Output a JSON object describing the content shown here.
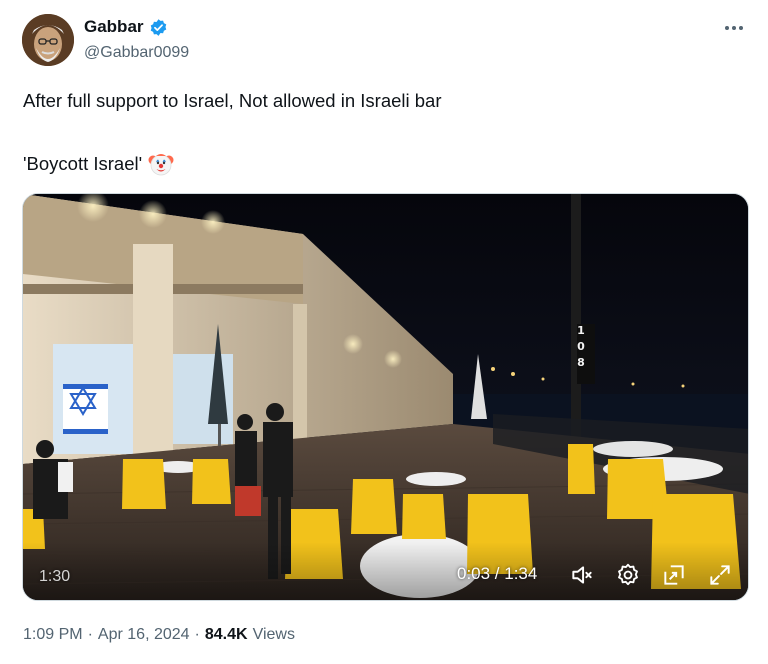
{
  "author": {
    "name": "Gabbar",
    "handle": "@Gabbar0099",
    "verified": true
  },
  "tweet": {
    "line1": "After full support to Israel, Not allowed in Israeli bar",
    "line2": "'Boycott Israel'",
    "emoji": "clown-face"
  },
  "video": {
    "counter": "1:30",
    "time": "0:03 / 1:34",
    "controls": [
      "mute-icon",
      "settings-icon",
      "fullscreen-exit-icon",
      "expand-icon"
    ]
  },
  "meta": {
    "time": "1:09 PM",
    "date": "Apr 16, 2024",
    "separator": "·",
    "views_count": "84.4K",
    "views_label": "Views"
  },
  "colors": {
    "verified": "#1d9bf0",
    "secondary_text": "#536471",
    "primary_text": "#0f1419"
  }
}
